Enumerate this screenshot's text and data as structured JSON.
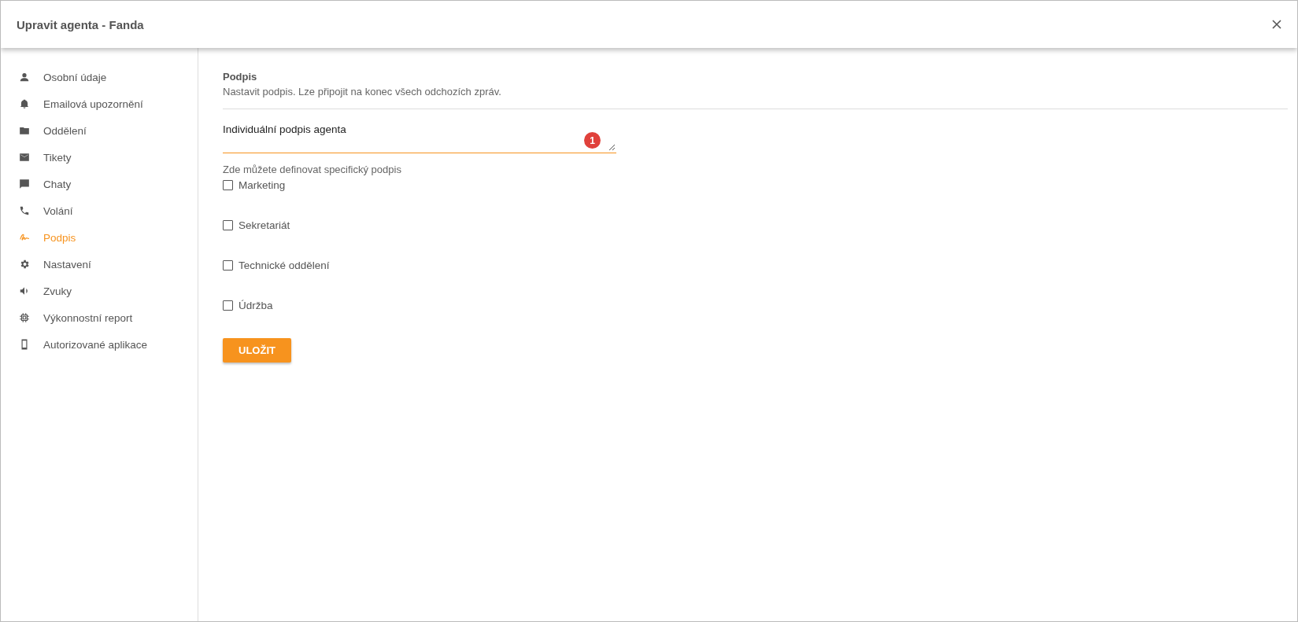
{
  "window": {
    "title": "Upravit agenta - Fanda"
  },
  "sidebar": {
    "items": [
      {
        "label": "Osobní údaje",
        "selected": false
      },
      {
        "label": "Emailová upozornění",
        "selected": false
      },
      {
        "label": "Oddělení",
        "selected": false
      },
      {
        "label": "Tikety",
        "selected": false
      },
      {
        "label": "Chaty",
        "selected": false
      },
      {
        "label": "Volání",
        "selected": false
      },
      {
        "label": "Podpis",
        "selected": true
      },
      {
        "label": "Nastavení",
        "selected": false
      },
      {
        "label": "Zvuky",
        "selected": false
      },
      {
        "label": "Výkonnostní report",
        "selected": false
      },
      {
        "label": "Autorizované aplikace",
        "selected": false
      }
    ]
  },
  "section": {
    "title": "Podpis",
    "description": "Nastavit podpis. Lze připojit na konec všech odchozích zpráv."
  },
  "signature_field": {
    "value": "Individuální podpis agenta",
    "badge": "1"
  },
  "departments": {
    "hint": "Zde můžete definovat specifický podpis",
    "options": [
      {
        "label": "Marketing",
        "checked": false
      },
      {
        "label": "Sekretariát",
        "checked": false
      },
      {
        "label": "Technické oddělení",
        "checked": false
      },
      {
        "label": "Údržba",
        "checked": false
      }
    ]
  },
  "save_button": "ULOŽIT"
}
